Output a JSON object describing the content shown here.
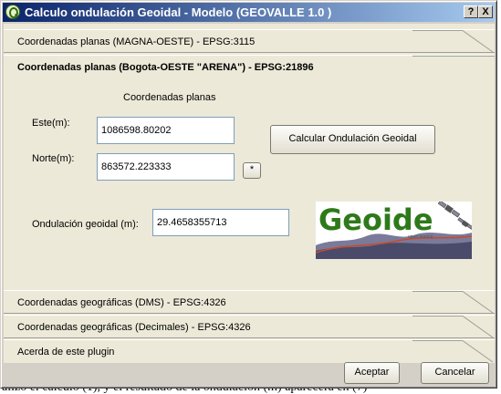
{
  "window": {
    "title": "Calculo ondulación Geoidal - Modelo (GEOVALLE 1.0 )",
    "help_button": "?",
    "close_button": "X"
  },
  "sections": [
    {
      "label": "Coordenadas planas (MAGNA-OESTE) - EPSG:3115",
      "active": false
    },
    {
      "label": "Coordenadas planas (Bogota-OESTE \"ARENA\") - EPSG:21896",
      "active": true
    },
    {
      "label": "Coordenadas geográficas (DMS) - EPSG:4326",
      "active": false
    },
    {
      "label": "Coordenadas geográficas (Decimales) - EPSG:4326",
      "active": false
    },
    {
      "label": "Acerda de este plugin",
      "active": false
    }
  ],
  "panel": {
    "heading": "Coordenadas planas",
    "este_label": "Este(m):",
    "este_value": "1086598.80202",
    "norte_label": "Norte(m):",
    "norte_value": "863572.223333",
    "star_button": "*",
    "calc_button": "Calcular Ondulación Geoidal",
    "ondulacion_label": "Ondulación geoidal (m):",
    "ondulacion_value": "29.4658355713"
  },
  "logo": {
    "text": "Geoide",
    "subtext": "open source"
  },
  "footer": {
    "ok_button": "Aceptar",
    "cancel_button": "Cancelar"
  },
  "background_text": "alizo el calculo (1), y el resultado de la ondulación (m) aparecerá en (7)"
}
